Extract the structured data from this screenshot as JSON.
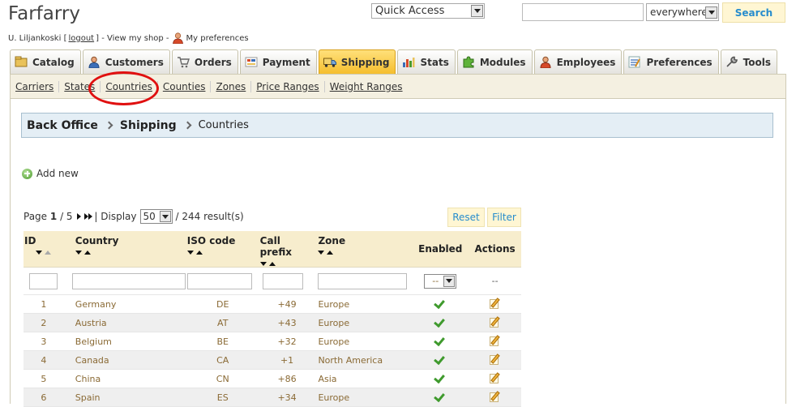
{
  "header": {
    "shop_name": "Farfarry",
    "user_name": "U. Liljankoski",
    "logout_label": "logout",
    "view_shop_label": "View my shop",
    "preferences_label": "My preferences"
  },
  "quick_access": {
    "selected": "Quick Access"
  },
  "search": {
    "value": "",
    "scope": "everywhere",
    "button_label": "Search"
  },
  "tabs": [
    {
      "label": "Catalog",
      "icon": "catalog-icon"
    },
    {
      "label": "Customers",
      "icon": "customers-icon"
    },
    {
      "label": "Orders",
      "icon": "cart-icon"
    },
    {
      "label": "Payment",
      "icon": "payment-icon"
    },
    {
      "label": "Shipping",
      "icon": "truck-icon",
      "active": true
    },
    {
      "label": "Stats",
      "icon": "chart-icon"
    },
    {
      "label": "Modules",
      "icon": "puzzle-icon"
    },
    {
      "label": "Employees",
      "icon": "employees-icon"
    },
    {
      "label": "Preferences",
      "icon": "preferences-icon"
    },
    {
      "label": "Tools",
      "icon": "wrench-icon"
    }
  ],
  "subtabs": [
    "Carriers",
    "States",
    "Countries",
    "Counties",
    "Zones",
    "Price Ranges",
    "Weight Ranges"
  ],
  "highlight_color": "#e01010",
  "breadcrumb": {
    "items": [
      "Back Office",
      "Shipping"
    ],
    "current": "Countries"
  },
  "add_new_label": "Add new",
  "pager": {
    "page_label": "Page",
    "current_page": "1",
    "total_pages": "/ 5",
    "display_label": "| Display",
    "per_page": "50",
    "results": "/ 244 result(s)"
  },
  "buttons": {
    "reset": "Reset",
    "filter": "Filter"
  },
  "table": {
    "headers": {
      "id": "ID",
      "country": "Country",
      "iso": "ISO code",
      "prefix": "Call prefix",
      "zone": "Zone",
      "enabled": "Enabled",
      "actions": "Actions"
    },
    "filter_enabled_value": "--",
    "filter_actions_text": "--",
    "rows": [
      {
        "id": "1",
        "country": "Germany",
        "iso": "DE",
        "prefix": "+49",
        "zone": "Europe"
      },
      {
        "id": "2",
        "country": "Austria",
        "iso": "AT",
        "prefix": "+43",
        "zone": "Europe"
      },
      {
        "id": "3",
        "country": "Belgium",
        "iso": "BE",
        "prefix": "+32",
        "zone": "Europe"
      },
      {
        "id": "4",
        "country": "Canada",
        "iso": "CA",
        "prefix": "+1",
        "zone": "North America"
      },
      {
        "id": "5",
        "country": "China",
        "iso": "CN",
        "prefix": "+86",
        "zone": "Asia"
      },
      {
        "id": "6",
        "country": "Spain",
        "iso": "ES",
        "prefix": "+34",
        "zone": "Europe"
      }
    ]
  }
}
